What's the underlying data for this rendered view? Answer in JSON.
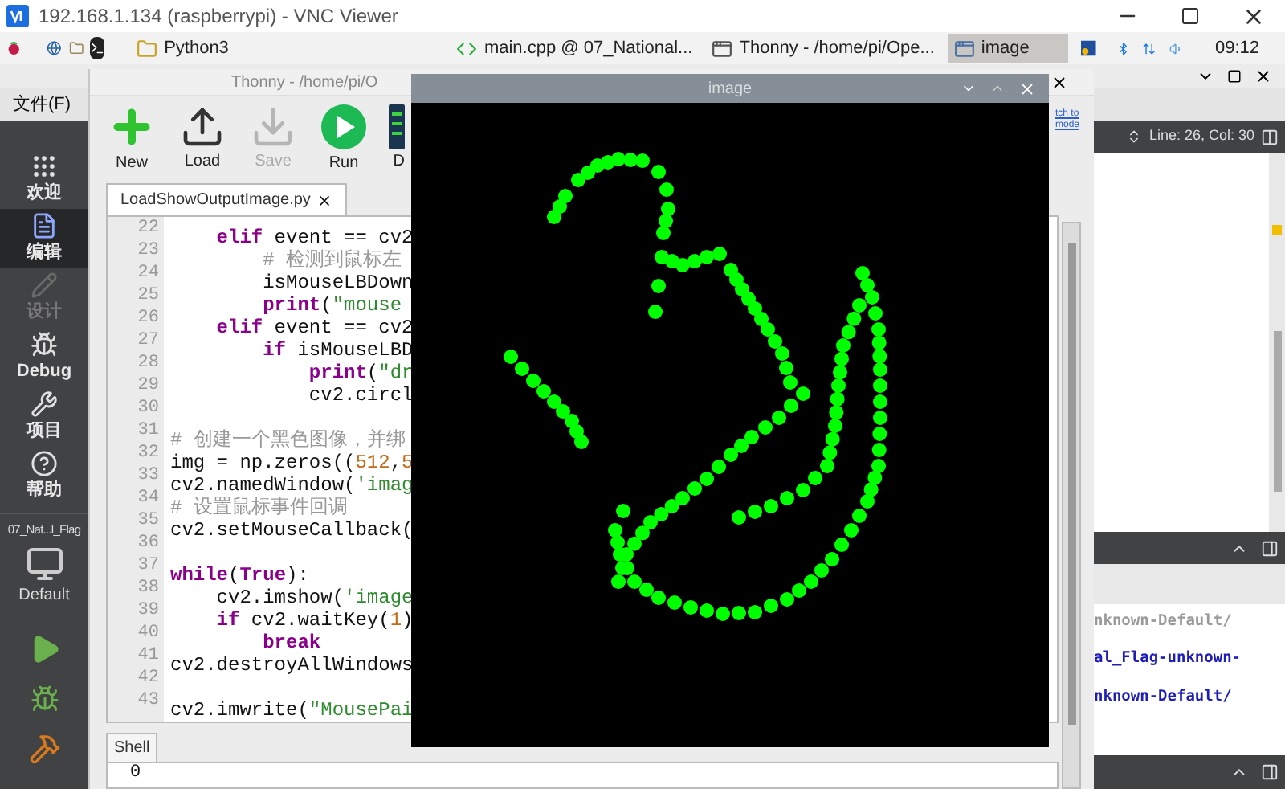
{
  "vnc_window": {
    "title": "192.168.1.134 (raspberrypi) - VNC Viewer"
  },
  "taskbar": {
    "items": [
      {
        "label": "Python3",
        "kind": "folder",
        "selected": false
      },
      {
        "label": "main.cpp @ 07_National...",
        "kind": "qt",
        "selected": false
      },
      {
        "label": "Thonny  -  /home/pi/Ope...",
        "kind": "thonny",
        "selected": false
      },
      {
        "label": "image",
        "kind": "window",
        "selected": true
      }
    ],
    "clock": "09:12"
  },
  "qt_creator": {
    "menu": [
      "文件(F)"
    ],
    "modes": [
      {
        "label": "欢迎",
        "kind": "welcome",
        "selected": false,
        "disabled": false
      },
      {
        "label": "编辑",
        "kind": "edit",
        "selected": true,
        "disabled": false
      },
      {
        "label": "设计",
        "kind": "design",
        "selected": false,
        "disabled": true
      },
      {
        "label": "Debug",
        "kind": "debug",
        "selected": false,
        "disabled": false
      },
      {
        "label": "项目",
        "kind": "projects",
        "selected": false,
        "disabled": false
      },
      {
        "label": "帮助",
        "kind": "help",
        "selected": false,
        "disabled": false
      }
    ],
    "project": "07_Nat...l_Flag",
    "kit": "Default",
    "cursor_position": "Line: 26, Col: 30",
    "output_lines": [
      {
        "text": "nknown-Default/",
        "kind": "muted"
      },
      {
        "text": "al_Flag-unknown-",
        "kind": "link"
      },
      {
        "text": "nknown-Default/",
        "kind": "link"
      }
    ]
  },
  "thonny": {
    "title": "Thonny  -  /home/pi/O",
    "toolbar": [
      {
        "label": "New",
        "kind": "new",
        "disabled": false
      },
      {
        "label": "Load",
        "kind": "load",
        "disabled": false
      },
      {
        "label": "Save",
        "kind": "save",
        "disabled": true
      },
      {
        "label": "Run",
        "kind": "run",
        "disabled": false
      },
      {
        "label": "D",
        "kind": "debug",
        "disabled": false
      }
    ],
    "mode_link": "tch to mode",
    "editor_tab": "LoadShowOutputImage.py",
    "code_lines": [
      {
        "number": "22",
        "tokens": [
          {
            "kind": "keyword",
            "text": "    elif"
          },
          {
            "kind": "plain",
            "text": " event == cv2"
          }
        ]
      },
      {
        "number": "23",
        "tokens": [
          {
            "kind": "comment",
            "text": "        # 检测到鼠标左"
          }
        ]
      },
      {
        "number": "24",
        "tokens": [
          {
            "kind": "plain",
            "text": "        isMouseLBDown"
          }
        ]
      },
      {
        "number": "25",
        "tokens": [
          {
            "kind": "keyword",
            "text": "        print"
          },
          {
            "kind": "plain",
            "text": "("
          },
          {
            "kind": "string",
            "text": "\"mouse"
          }
        ]
      },
      {
        "number": "26",
        "tokens": [
          {
            "kind": "keyword",
            "text": "    elif"
          },
          {
            "kind": "plain",
            "text": " event == cv2"
          }
        ]
      },
      {
        "number": "27",
        "tokens": [
          {
            "kind": "keyword",
            "text": "        if"
          },
          {
            "kind": "plain",
            "text": " isMouseLBD"
          }
        ]
      },
      {
        "number": "28",
        "tokens": [
          {
            "kind": "keyword",
            "text": "            print"
          },
          {
            "kind": "plain",
            "text": "("
          },
          {
            "kind": "string",
            "text": "\"dr"
          }
        ]
      },
      {
        "number": "29",
        "tokens": [
          {
            "kind": "plain",
            "text": "            cv2.circl"
          }
        ]
      },
      {
        "number": "30"
      },
      {
        "number": "31",
        "tokens": [
          {
            "kind": "comment",
            "text": "# 创建一个黑色图像，并绑"
          }
        ]
      },
      {
        "number": "32",
        "tokens": [
          {
            "kind": "plain",
            "text": "img = np.zeros(("
          },
          {
            "kind": "number",
            "text": "512"
          },
          {
            "kind": "plain",
            "text": ","
          },
          {
            "kind": "number",
            "text": "5"
          }
        ]
      },
      {
        "number": "33",
        "tokens": [
          {
            "kind": "plain",
            "text": "cv2.namedWindow("
          },
          {
            "kind": "string",
            "text": "'imag"
          }
        ]
      },
      {
        "number": "34",
        "tokens": [
          {
            "kind": "comment",
            "text": "# 设置鼠标事件回调"
          }
        ]
      },
      {
        "number": "35",
        "tokens": [
          {
            "kind": "plain",
            "text": "cv2.setMouseCallback("
          }
        ]
      },
      {
        "number": "36"
      },
      {
        "number": "37",
        "tokens": [
          {
            "kind": "keyword",
            "text": "while"
          },
          {
            "kind": "plain",
            "text": "("
          },
          {
            "kind": "keyword",
            "text": "True"
          },
          {
            "kind": "plain",
            "text": "):"
          }
        ]
      },
      {
        "number": "38",
        "tokens": [
          {
            "kind": "plain",
            "text": "    cv2.imshow("
          },
          {
            "kind": "string",
            "text": "'image"
          }
        ]
      },
      {
        "number": "39",
        "tokens": [
          {
            "kind": "keyword",
            "text": "    if"
          },
          {
            "kind": "plain",
            "text": " cv2.waitKey("
          },
          {
            "kind": "number",
            "text": "1"
          },
          {
            "kind": "plain",
            "text": ")"
          }
        ]
      },
      {
        "number": "40",
        "tokens": [
          {
            "kind": "keyword",
            "text": "        break"
          }
        ]
      },
      {
        "number": "41",
        "tokens": [
          {
            "kind": "plain",
            "text": "cv2.destroyAllWindows"
          }
        ]
      },
      {
        "number": "42"
      },
      {
        "number": "43",
        "tokens": [
          {
            "kind": "plain",
            "text": "cv2.imwrite("
          },
          {
            "kind": "string",
            "text": "\"MousePai"
          }
        ]
      }
    ],
    "shell_tab": "Shell",
    "shell_lines": [
      "0"
    ]
  },
  "image_window": {
    "title": "image"
  }
}
